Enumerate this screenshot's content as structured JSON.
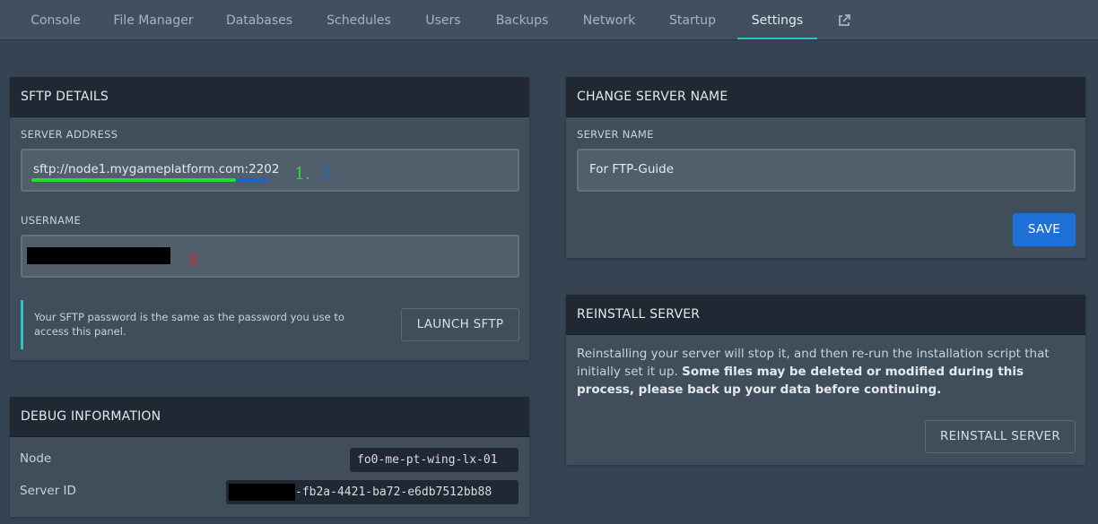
{
  "nav": {
    "tabs": [
      {
        "label": "Console"
      },
      {
        "label": "File Manager"
      },
      {
        "label": "Databases"
      },
      {
        "label": "Schedules"
      },
      {
        "label": "Users"
      },
      {
        "label": "Backups"
      },
      {
        "label": "Network"
      },
      {
        "label": "Startup"
      },
      {
        "label": "Settings"
      }
    ],
    "active_tab": "Settings",
    "external_icon": "external-link-icon"
  },
  "sftp": {
    "title": "SFTP DETAILS",
    "server_address_label": "SERVER ADDRESS",
    "server_address_value": "sftp://node1.mygameplatform.com:2202",
    "username_label": "USERNAME",
    "username_value": "",
    "info_text": "Your SFTP password is the same as the password you use to access this panel.",
    "launch_label": "LAUNCH SFTP"
  },
  "annotations": {
    "one": "1.",
    "two": "2.",
    "three": "3.",
    "colors": {
      "one": "#22e02a",
      "two": "#1e64c8",
      "three": "#d9243a"
    }
  },
  "debug": {
    "title": "DEBUG INFORMATION",
    "node_label": "Node",
    "node_value": "fo0-me-pt-wing-lx-01",
    "server_id_label": "Server ID",
    "server_id_value": "-fb2a-4421-ba72-e6db7512bb88"
  },
  "rename": {
    "title": "CHANGE SERVER NAME",
    "field_label": "SERVER NAME",
    "field_value": "For FTP-Guide",
    "save_label": "SAVE"
  },
  "reinstall": {
    "title": "REINSTALL SERVER",
    "text_normal": "Reinstalling your server will stop it, and then re-run the installation script that initially set it up.",
    "text_bold": "Some files may be deleted or modified during this process, please back up your data before continuing.",
    "button_label": "REINSTALL SERVER"
  },
  "colors": {
    "accent": "#2bc3c3",
    "primary": "#1f6fd8",
    "background": "#364352",
    "panel": "#404d5b",
    "panel_header": "#1f2833"
  }
}
